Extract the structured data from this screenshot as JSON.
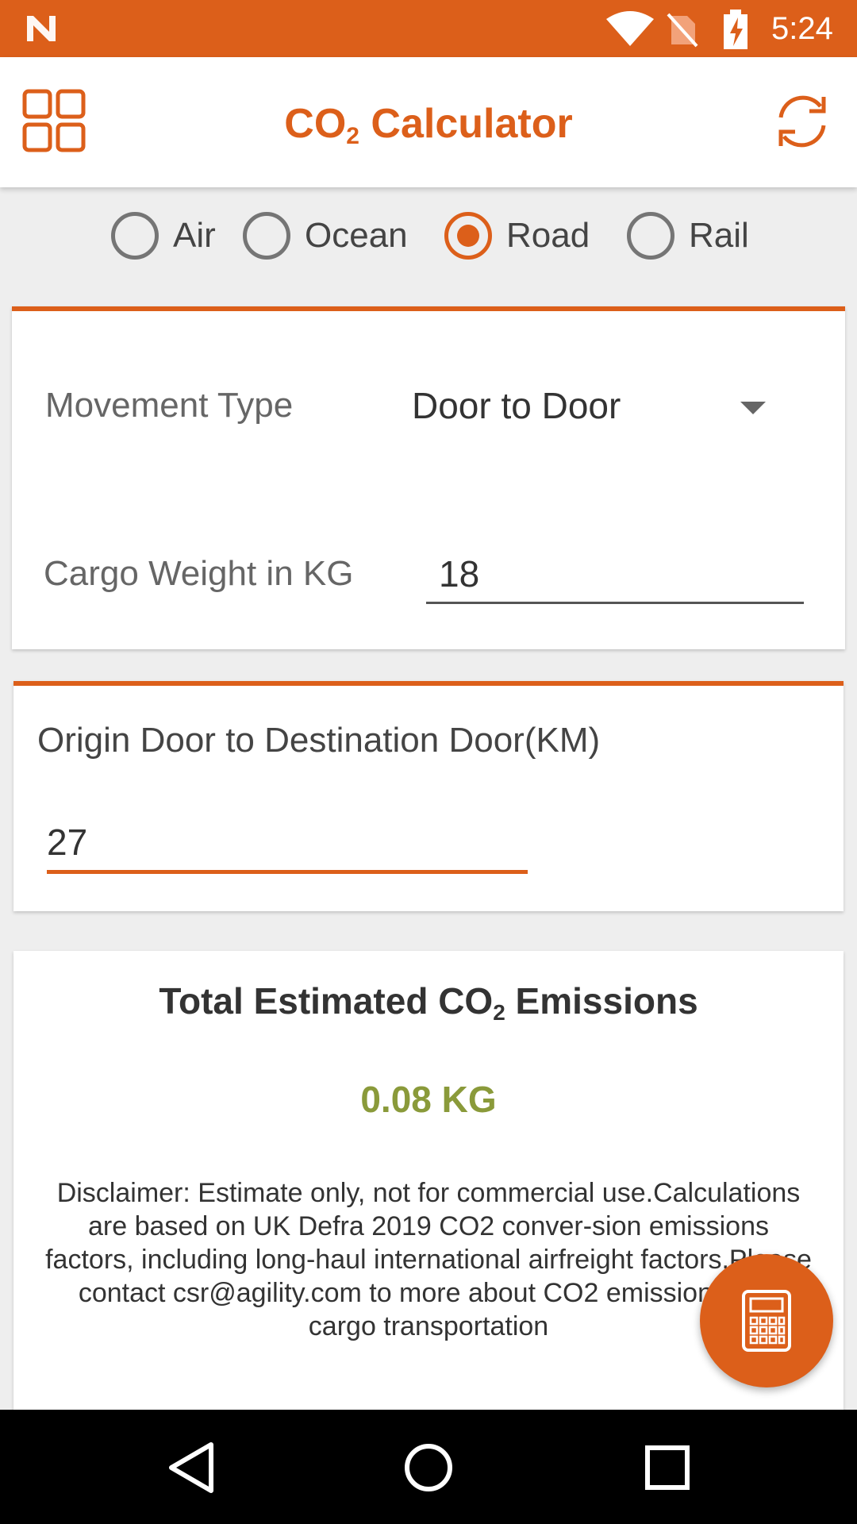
{
  "status_bar": {
    "time": "5:24",
    "icons": [
      "n-logo-icon",
      "wifi-icon",
      "no-sim-icon",
      "battery-charging-icon"
    ]
  },
  "app_bar": {
    "title_main": "CO",
    "title_sub": "2",
    "title_rest": " Calculator",
    "left_icon": "grid-icon",
    "right_icon": "refresh-icon"
  },
  "transport_modes": {
    "options": [
      {
        "label": "Air",
        "checked": false
      },
      {
        "label": "Ocean",
        "checked": false
      },
      {
        "label": "Road",
        "checked": true
      },
      {
        "label": "Rail",
        "checked": false
      }
    ]
  },
  "form": {
    "movement_type_label": "Movement Type",
    "movement_type_value": "Door to Door",
    "cargo_weight_label": "Cargo Weight in KG",
    "cargo_weight_value": "18"
  },
  "distance": {
    "label": "Origin Door to Destination Door(KM)",
    "value": "27"
  },
  "result": {
    "title_pre": "Total Estimated CO",
    "title_sub": "2",
    "title_post": " Emissions",
    "value": "0.08 KG",
    "disclaimer": "Disclaimer: Estimate only, not for commercial use.Calculations are based on UK Defra 2019 CO2 conver-sion emissions factors, including long-haul international airfreight factors.Please contact csr@agility.com to more about CO2 emissions and cargo transportation"
  },
  "fab": {
    "icon": "calculator-icon"
  },
  "nav_bar": {
    "icons": [
      "back-icon",
      "home-icon",
      "recents-icon"
    ]
  },
  "colors": {
    "accent": "#dc5f1a",
    "result": "#8a9a3a"
  }
}
